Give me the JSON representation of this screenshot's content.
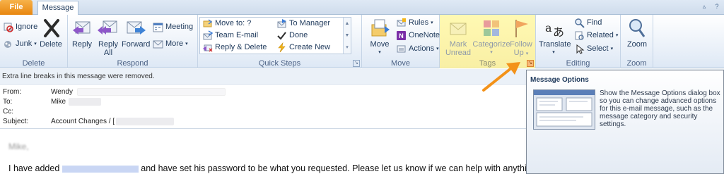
{
  "tabs": {
    "file": "File",
    "message": "Message"
  },
  "groups": {
    "delete": {
      "label": "Delete",
      "ignore": "Ignore",
      "junk": "Junk",
      "delete": "Delete"
    },
    "respond": {
      "label": "Respond",
      "reply": "Reply",
      "reply_all_1": "Reply",
      "reply_all_2": "All",
      "forward": "Forward",
      "meeting": "Meeting",
      "more": "More"
    },
    "quick_steps": {
      "label": "Quick Steps",
      "items": [
        "Move to: ?",
        "Team E-mail",
        "Reply & Delete",
        "To Manager",
        "Done",
        "Create New"
      ]
    },
    "move": {
      "label": "Move",
      "move": "Move",
      "rules": "Rules",
      "onenote": "OneNote",
      "actions": "Actions"
    },
    "tags": {
      "label": "Tags",
      "mark_unread_1": "Mark",
      "mark_unread_2": "Unread",
      "categorize_1": "Categorize",
      "follow_up_1": "Follow",
      "follow_up_2": "Up"
    },
    "editing": {
      "label": "Editing",
      "translate": "Translate",
      "find": "Find",
      "related": "Related",
      "select": "Select"
    },
    "zoom": {
      "label": "Zoom",
      "zoom": "Zoom"
    }
  },
  "message": {
    "info_bar": "Extra line breaks in this message were removed.",
    "from_label": "From:",
    "from_value": "Wendy",
    "to_label": "To:",
    "to_value": "Mike",
    "cc_label": "Cc:",
    "subject_label": "Subject:",
    "subject_value": "Account Changes / [",
    "body_greeting": "Mike,",
    "body_pre": "I have added",
    "body_post": "and have set his password to be what you requested. Please let us know if we can help with anythin"
  },
  "tooltip": {
    "title": "Message Options",
    "text": "Show the Message Options dialog box so you can change advanced options for this e-mail message, such as the message category and security settings."
  },
  "colors": {
    "file_tab": "#e8860f",
    "tags_highlight": "#fdf09a",
    "arrow": "#f39219",
    "link": "#3a6fd8"
  }
}
